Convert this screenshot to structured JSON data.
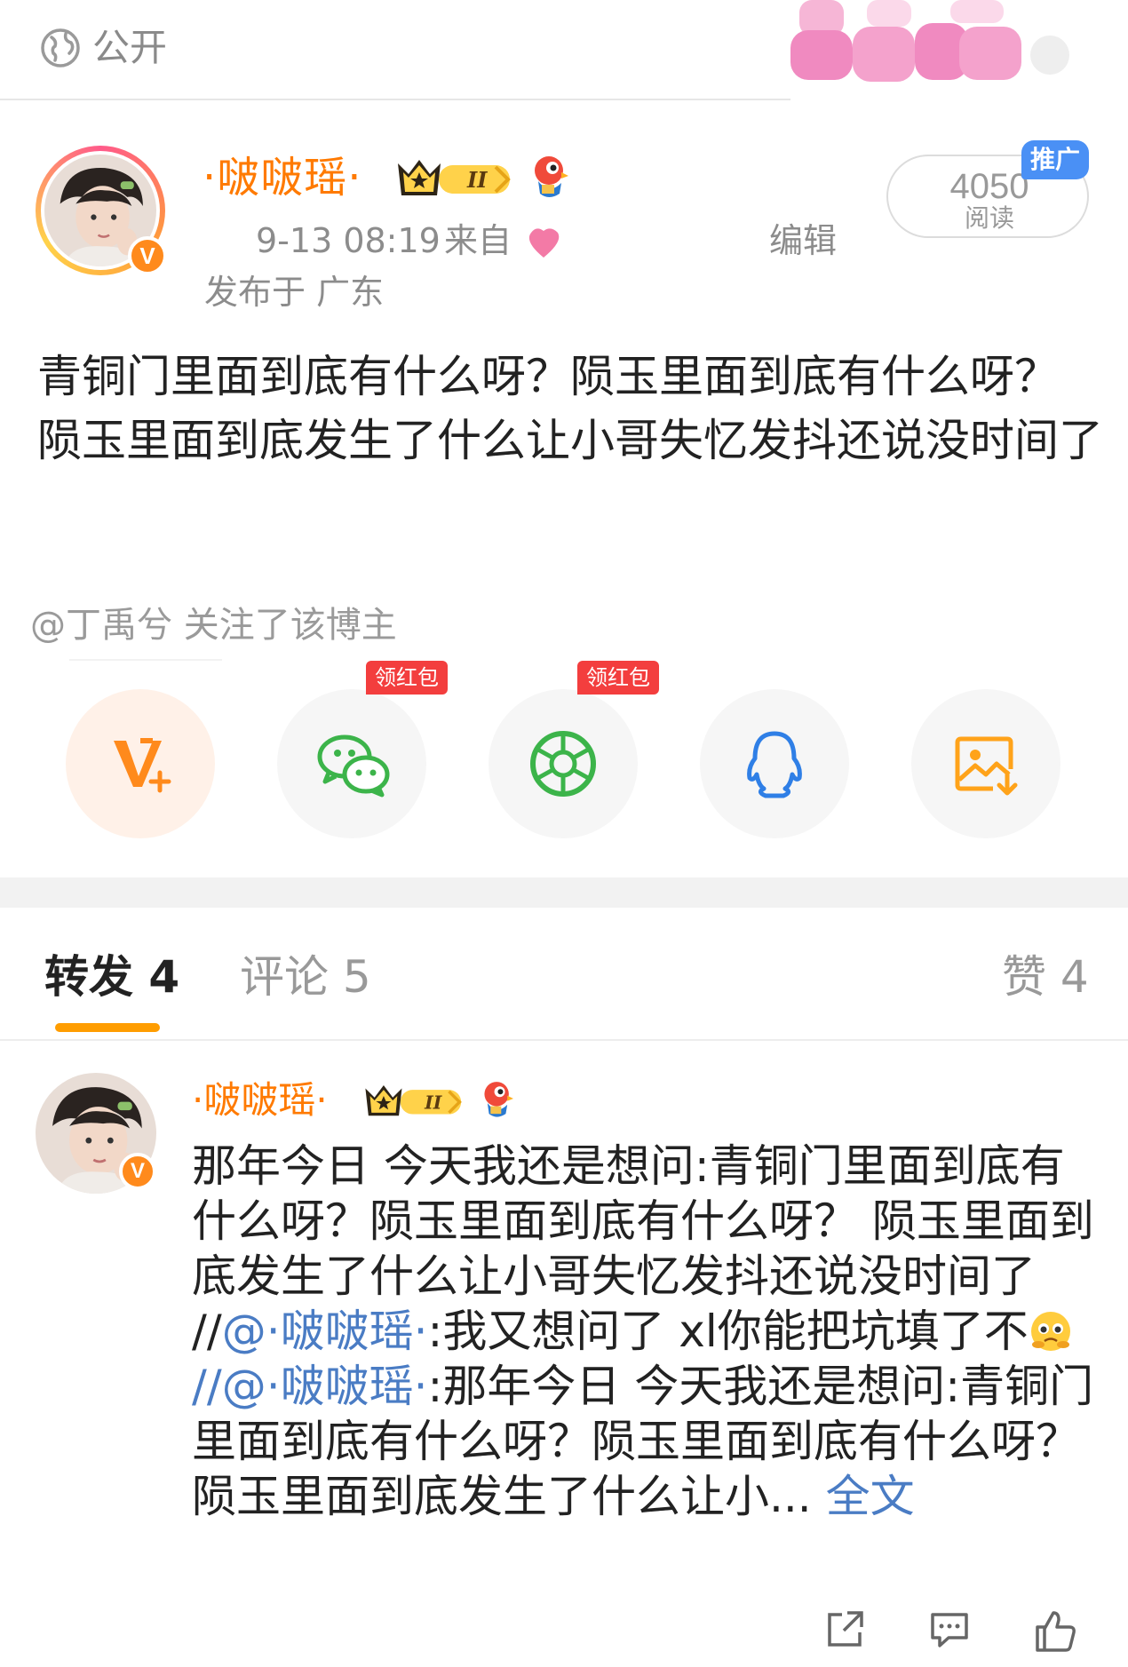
{
  "top": {
    "visibility_label": "公开"
  },
  "post": {
    "username": "·啵啵瑶·",
    "time": "9-13 08:19",
    "from_label": "来自",
    "edit_label": "编辑",
    "location": "发布于 广东",
    "read_count": "4050",
    "read_label": "阅读",
    "promo_badge": "推广",
    "body": "青铜门里面到底有什么呀？陨玉里面到底有什么呀？ 陨玉里面到底发生了什么让小哥失忆发抖还说没时间了",
    "follow_note": "@丁禹兮 关注了该博主"
  },
  "share": {
    "buttons": [
      {
        "name": "vplus",
        "icon": "v-plus-icon"
      },
      {
        "name": "wechat",
        "icon": "wechat-icon",
        "badge": "领红包"
      },
      {
        "name": "moments",
        "icon": "moments-icon",
        "badge": "领红包"
      },
      {
        "name": "qq",
        "icon": "qq-icon"
      },
      {
        "name": "save-image",
        "icon": "save-image-icon"
      }
    ]
  },
  "tabs": {
    "repost": "转发 4",
    "comment": "评论 5",
    "like": "赞 4"
  },
  "repost": {
    "username": "·啵啵瑶·",
    "part1": "那年今日 今天我还是想问:青铜门里面到底有什么呀？陨玉里面到底有什么呀？ 陨玉里面到底发生了什么让小哥失忆发抖还说没时间了 //",
    "mention1": "@·啵啵瑶·",
    "part2": ":我又想问了 xl你能把坑填了不",
    "mention2": "//@·啵啵瑶·",
    "part3": ":那年今日 今天我还是想问:青铜门里面到底有什么呀？陨玉里面到底有什么呀？ 陨玉里面到底发生了什么让小...",
    "fulltext": "全文"
  },
  "colors": {
    "username": "#ff7a00",
    "link": "#4a7cc4",
    "tab_indicator": "#ff9d00",
    "redpack": "#f33e3e",
    "promo": "#4a90f5"
  }
}
